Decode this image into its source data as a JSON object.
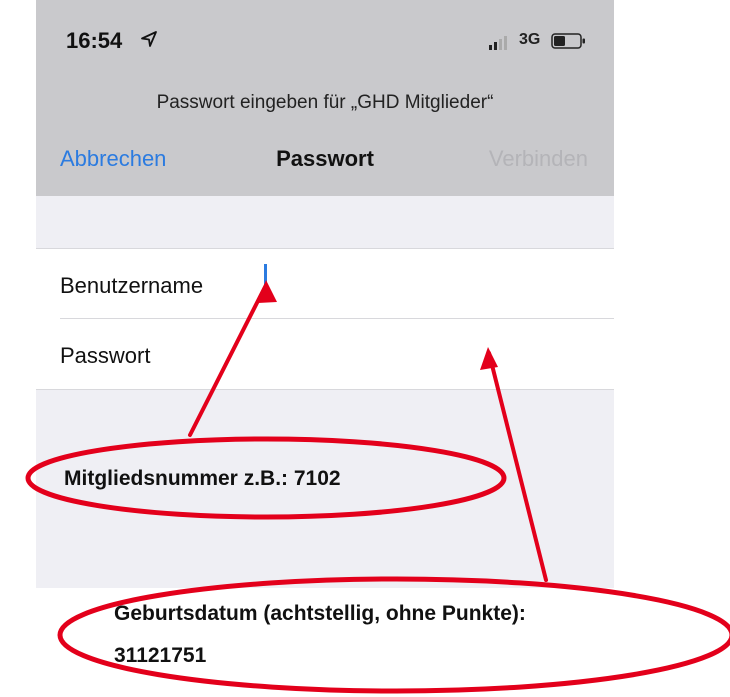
{
  "status_bar": {
    "time": "16:54",
    "network": "3G",
    "icons": [
      "location-arrow-icon",
      "signal-icon",
      "battery-icon"
    ]
  },
  "dialog": {
    "prompt": "Passwort eingeben für „GHD Mitglieder“",
    "cancel_label": "Abbrechen",
    "title": "Passwort",
    "connect_label": "Verbinden"
  },
  "form": {
    "username_label": "Benutzername",
    "username_value": "",
    "password_label": "Passwort",
    "password_value": ""
  },
  "annotations": {
    "member_number_note": "Mitgliedsnummer z.B.: 7102",
    "birthdate_note_line1": "Geburtsdatum (achtstellig, ohne Punkte):",
    "birthdate_note_line2": "31121751"
  },
  "colors": {
    "accent": "#2b7be0",
    "annotation": "#e3001b",
    "disabled": "#b4b4b8",
    "bar": "#c9c9cc"
  }
}
